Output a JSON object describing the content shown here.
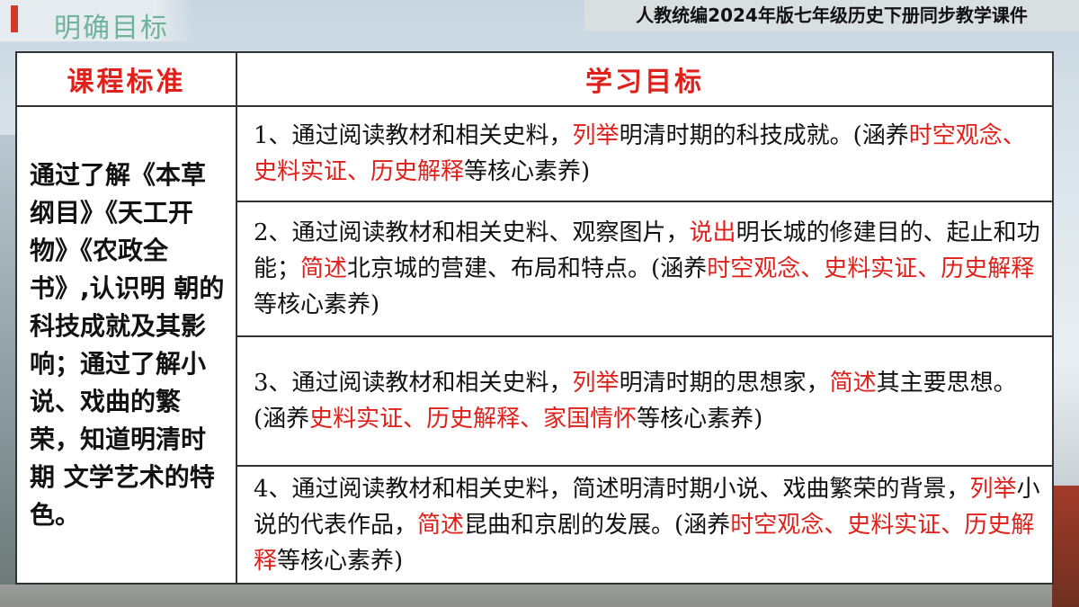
{
  "header": {
    "title": "明确目标",
    "course_tag": "人教统编2024年版七年级历史下册同步教学课件"
  },
  "table": {
    "col1_header": "课程标准",
    "col2_header": "学习目标",
    "standard_text": "通过了解《本草纲目》《天工开物》《农政全书》,认识明 朝的科技成就及其影响；通过了解小说、戏曲的繁荣，知道明清时期 文学艺术的特色。",
    "goals": [
      {
        "p1": "1、通过阅读教材和相关史料，",
        "h1": "列举",
        "p2": "明清时期的科技成就。(涵养",
        "h2": "时空观念、史料实证、历史解释",
        "p3": "等核心素养)"
      },
      {
        "p1": "2、通过阅读教材和相关史料、观察图片，",
        "h1": "说出",
        "p2": "明长城的修建目的、起止和功能；",
        "h2": "简述",
        "p3": "北京城的营建、布局和特点。(涵养",
        "h3": "时空观念、史料实证、历史解释",
        "p4": "等核心素养)"
      },
      {
        "p1": "3、通过阅读教材和相关史料，",
        "h1": "列举",
        "p2": "明清时期的思想家，",
        "h2": "简述",
        "p3": "其主要思想。(涵养",
        "h3": "史料实证、历史解释、家国情怀",
        "p4": "等核心素养)"
      },
      {
        "p1": "4、通过阅读教材和相关史料，简述明清时期小说、戏曲繁荣的背景，",
        "h1": "列举",
        "p2": "小说的代表作品，",
        "h2": "简述",
        "p3": "昆曲和京剧的发展。(涵养",
        "h3": "时空观念、史料实证、历史解释",
        "p4": "等核心素养)"
      }
    ]
  },
  "colors": {
    "highlight": "#e0201a",
    "title": "#6fb39a",
    "accent": "#d23a2b"
  }
}
